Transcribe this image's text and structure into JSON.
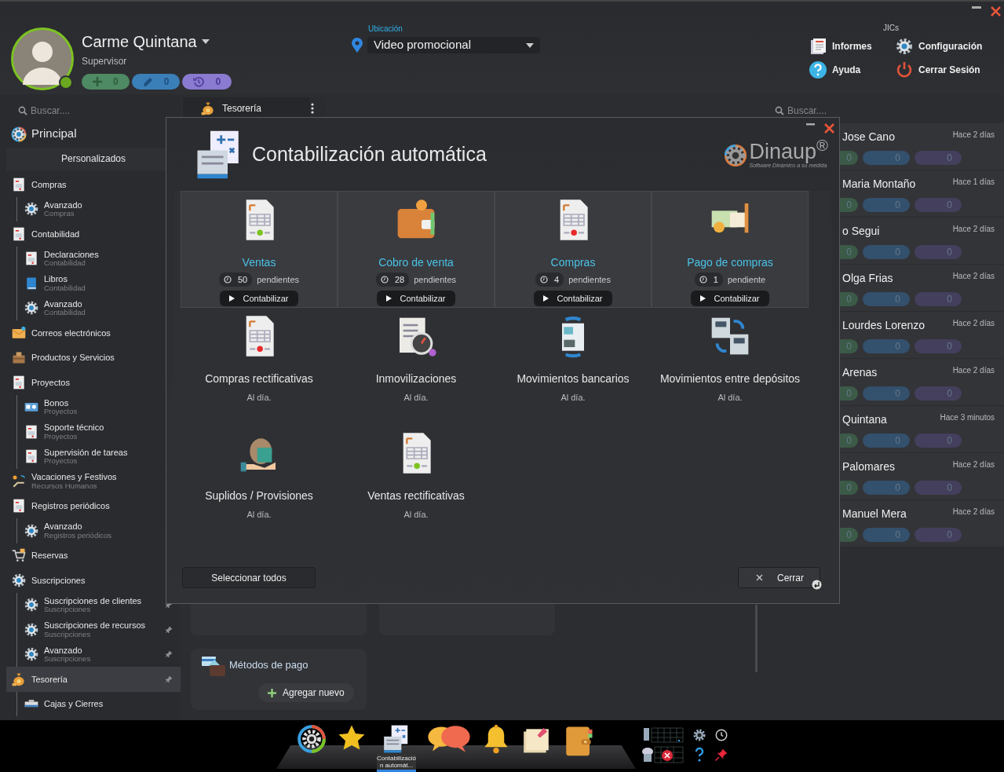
{
  "user": {
    "name": "Carme Quintana",
    "role": "Supervisor",
    "online": true,
    "counters": [
      {
        "kind": "add",
        "value": "0"
      },
      {
        "kind": "edit",
        "value": "0"
      },
      {
        "kind": "history",
        "value": "0"
      }
    ]
  },
  "location": {
    "label": "Ubicación",
    "value": "Video promocional"
  },
  "jics": {
    "title": "JICs",
    "actions": [
      {
        "kind": "reports",
        "label": "Informes"
      },
      {
        "kind": "settings",
        "label": "Configuración"
      },
      {
        "kind": "help",
        "label": "Ayuda"
      },
      {
        "kind": "logout",
        "label": "Cerrar Sesión"
      }
    ]
  },
  "sidebar": {
    "search_placeholder": "Buscar....",
    "home": "Principal",
    "section": "Personalizados",
    "items": [
      {
        "label": "Compras",
        "selected": false,
        "children": [
          {
            "label": "Avanzado",
            "subtitle": "Compras",
            "selected": false
          }
        ]
      },
      {
        "label": "Contabilidad",
        "selected": false,
        "children": [
          {
            "label": "Declaraciones",
            "subtitle": "Contabilidad",
            "selected": false
          },
          {
            "label": "Libros",
            "subtitle": "Contabilidad",
            "selected": false
          },
          {
            "label": "Avanzado",
            "subtitle": "Contabilidad",
            "selected": false
          }
        ]
      },
      {
        "label": "Correos electrónicos",
        "selected": false
      },
      {
        "label": "Productos y Servicios",
        "selected": false
      },
      {
        "label": "Proyectos",
        "selected": false,
        "children": [
          {
            "label": "Bonos",
            "subtitle": "Proyectos",
            "selected": false
          },
          {
            "label": "Soporte técnico",
            "subtitle": "Proyectos",
            "selected": false
          },
          {
            "label": "Supervisión de tareas",
            "subtitle": "Proyectos",
            "selected": false
          }
        ]
      },
      {
        "label": "Vacaciones y Festivos",
        "subtitle": "Recursos Humanos",
        "selected": false
      },
      {
        "label": "Registros periódicos",
        "selected": false,
        "children": [
          {
            "label": "Avanzado",
            "subtitle": "Registros periódicos",
            "selected": false
          }
        ]
      },
      {
        "label": "Reservas",
        "selected": false
      },
      {
        "label": "Suscripciones",
        "selected": false,
        "children": [
          {
            "label": "Suscripciones de clientes",
            "subtitle": "Suscripciones",
            "selected": false,
            "pinned": true
          },
          {
            "label": "Suscripciones de recursos",
            "subtitle": "Suscripciones",
            "selected": false,
            "pinned": true
          },
          {
            "label": "Avanzado",
            "subtitle": "Suscripciones",
            "selected": false,
            "pinned": true
          }
        ]
      },
      {
        "label": "Tesorería",
        "selected": true,
        "pinned": true,
        "children": [
          {
            "label": "Cajas y Cierres",
            "selected": false,
            "pinned": false
          }
        ]
      }
    ]
  },
  "tab": {
    "label": "Tesorería"
  },
  "main_cards": [
    {
      "title": "Métodos de pago",
      "action": "Agregar nuevo"
    }
  ],
  "right_panel": {
    "search_placeholder": "Buscar....",
    "people": [
      {
        "name": "Jose Cano",
        "time": "Hace 2 días",
        "counters": [
          "0",
          "0",
          "0"
        ]
      },
      {
        "name": "Maria Montaño",
        "time": "Hace 1 días",
        "counters": [
          "0",
          "0",
          "0"
        ]
      },
      {
        "name": "o Segui",
        "time": "Hace 2 días",
        "counters": [
          "0",
          "0",
          "0"
        ]
      },
      {
        "name": "Olga Frias",
        "time": "Hace 2 días",
        "counters": [
          "0",
          "0",
          "0"
        ]
      },
      {
        "name": "Lourdes Lorenzo",
        "time": "Hace 2 días",
        "counters": [
          "0",
          "0",
          "0"
        ]
      },
      {
        "name": "Arenas",
        "time": "Hace 2 días",
        "counters": [
          "0",
          "0",
          "0"
        ]
      },
      {
        "name": "Quintana",
        "time": "Hace 3 minutos",
        "counters": [
          "0",
          "0",
          "0"
        ]
      },
      {
        "name": "Palomares",
        "time": "Hace 2 días",
        "counters": [
          "0",
          "0",
          "0"
        ]
      },
      {
        "name": "Manuel Mera",
        "time": "Hace 2 días",
        "counters": [
          "0",
          "0",
          "0"
        ]
      }
    ]
  },
  "modal": {
    "title": "Contabilización automática",
    "logo": "Dinaup$^{®}$",
    "logo_tagline": "Software Dinámico a su medida",
    "tiles": [
      {
        "kind": "pending",
        "title": "Ventas",
        "count": "50",
        "status": "pendientes",
        "action": "Contabilizar"
      },
      {
        "kind": "pending",
        "title": "Cobro de venta",
        "count": "28",
        "status": "pendientes",
        "action": "Contabilizar"
      },
      {
        "kind": "pending",
        "title": "Compras",
        "count": "4",
        "status": "pendientes",
        "action": "Contabilizar"
      },
      {
        "kind": "pending",
        "title": "Pago de compras",
        "count": "1",
        "status": "pendiente",
        "action": "Contabilizar"
      },
      {
        "kind": "done",
        "title": "Compras rectificativas",
        "status": "Al día."
      },
      {
        "kind": "done",
        "title": "Inmovilizaciones",
        "status": "Al día."
      },
      {
        "kind": "done",
        "title": "Movimientos bancarios",
        "status": "Al día."
      },
      {
        "kind": "done",
        "title": "Movimientos entre depósitos",
        "status": "Al día."
      },
      {
        "kind": "done",
        "title": "Suplidos / Provisiones",
        "status": "Al día."
      },
      {
        "kind": "done",
        "title": "Ventas rectificativas",
        "status": "Al día."
      }
    ],
    "select_all": "Seleccionar todos",
    "close": "Cerrar"
  },
  "taskbar": {
    "apps": [
      {
        "selected": false
      },
      {
        "selected": false
      },
      {
        "selected": true,
        "label": "Contabilización automát..."
      },
      {
        "selected": false
      },
      {
        "selected": false
      },
      {
        "selected": false
      },
      {
        "selected": false
      }
    ]
  }
}
